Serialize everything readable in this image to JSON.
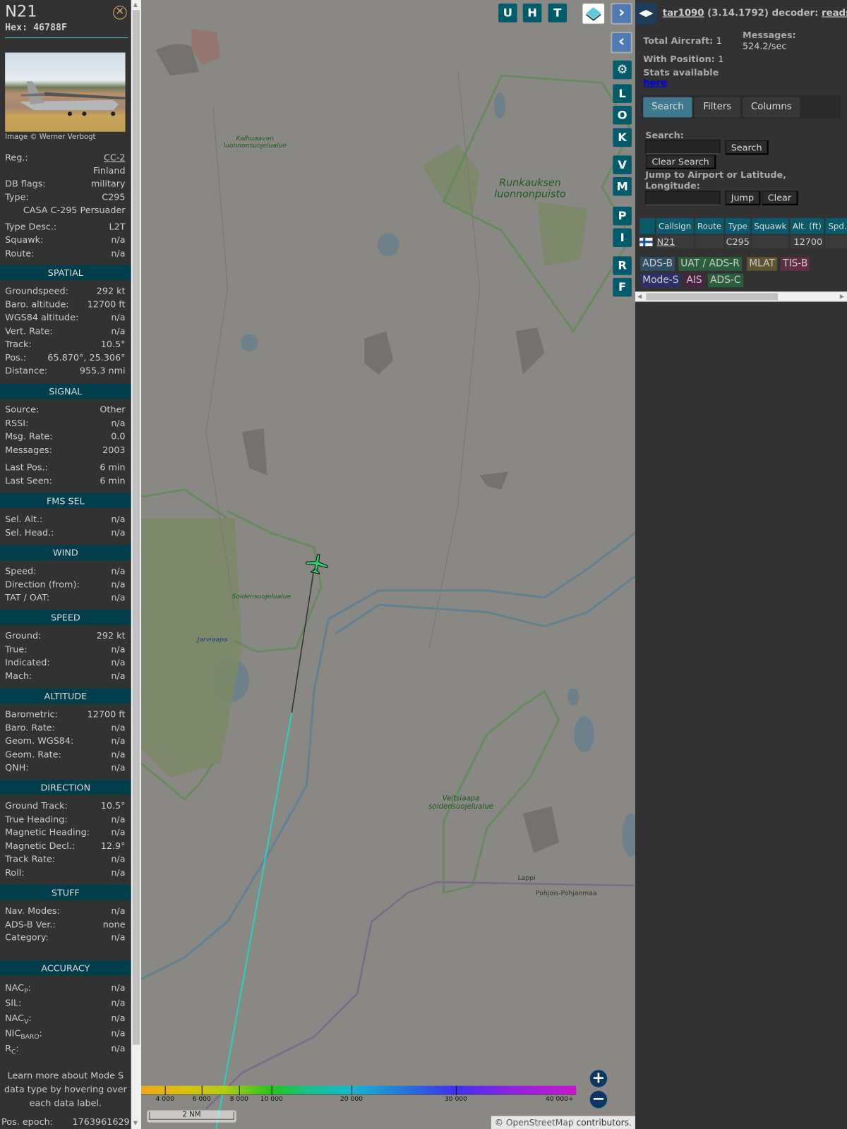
{
  "aircraft": {
    "callsign": "N21",
    "hex_label": "Hex: 46788F",
    "photo_credit": "Image © Werner Verbogt",
    "info": [
      {
        "label": "Reg.:",
        "value": "CC-2",
        "link": true
      },
      {
        "label": "",
        "value": "Finland"
      },
      {
        "label": "DB flags:",
        "value": "military"
      },
      {
        "label": "Type:",
        "value": "C295"
      },
      {
        "label": "",
        "value": "CASA C-295 Persuader"
      },
      {
        "label": "Type Desc.:",
        "value": "L2T"
      },
      {
        "label": "Squawk:",
        "value": "n/a"
      },
      {
        "label": "Route:",
        "value": "n/a"
      }
    ],
    "sections": [
      {
        "title": "SPATIAL",
        "rows": [
          {
            "label": "Groundspeed:",
            "value": "292 kt"
          },
          {
            "label": "Baro. altitude:",
            "value": "12700 ft"
          },
          {
            "label": "WGS84 altitude:",
            "value": "n/a"
          },
          {
            "label": "Vert. Rate:",
            "value": "n/a"
          },
          {
            "label": "Track:",
            "value": "10.5°"
          },
          {
            "label": "Pos.:",
            "value": "65.870°, 25.306°"
          },
          {
            "label": "Distance:",
            "value": "955.3 nmi"
          }
        ]
      },
      {
        "title": "SIGNAL",
        "rows": [
          {
            "label": "Source:",
            "value": "Other"
          },
          {
            "label": "RSSI:",
            "value": "n/a"
          },
          {
            "label": "Msg. Rate:",
            "value": "0.0"
          },
          {
            "label": "Messages:",
            "value": "2003"
          },
          {
            "label": "Last Pos.:",
            "value": "6 min"
          },
          {
            "label": "Last Seen:",
            "value": "6 min"
          }
        ]
      },
      {
        "title": "FMS SEL",
        "rows": [
          {
            "label": "Sel. Alt.:",
            "value": "n/a"
          },
          {
            "label": "Sel. Head.:",
            "value": "n/a"
          }
        ]
      },
      {
        "title": "WIND",
        "rows": [
          {
            "label": "Speed:",
            "value": "n/a"
          },
          {
            "label": "Direction (from):",
            "value": "n/a"
          },
          {
            "label": "TAT / OAT:",
            "value": "n/a"
          }
        ]
      },
      {
        "title": "SPEED",
        "rows": [
          {
            "label": "Ground:",
            "value": "292 kt"
          },
          {
            "label": "True:",
            "value": "n/a"
          },
          {
            "label": "Indicated:",
            "value": "n/a"
          },
          {
            "label": "Mach:",
            "value": "n/a"
          }
        ]
      },
      {
        "title": "ALTITUDE",
        "rows": [
          {
            "label": "Barometric:",
            "value": "12700 ft"
          },
          {
            "label": "Baro. Rate:",
            "value": "n/a"
          },
          {
            "label": "Geom. WGS84:",
            "value": "n/a"
          },
          {
            "label": "Geom. Rate:",
            "value": "n/a"
          },
          {
            "label": "QNH:",
            "value": "n/a"
          }
        ]
      },
      {
        "title": "DIRECTION",
        "rows": [
          {
            "label": "Ground Track:",
            "value": "10.5°"
          },
          {
            "label": "True Heading:",
            "value": "n/a"
          },
          {
            "label": "Magnetic Heading:",
            "value": "n/a"
          },
          {
            "label": "Magnetic Decl.:",
            "value": "12.9°"
          },
          {
            "label": "Track Rate:",
            "value": "n/a"
          },
          {
            "label": "Roll:",
            "value": "n/a"
          }
        ]
      },
      {
        "title": "STUFF",
        "rows": [
          {
            "label": "Nav. Modes:",
            "value": "n/a"
          },
          {
            "label": "ADS-B Ver.:",
            "value": "none"
          },
          {
            "label": "Category:",
            "value": "n/a"
          }
        ]
      },
      {
        "title": "ACCURACY",
        "rows": [
          {
            "label": "NAC",
            "sub": "P",
            "value": "n/a"
          },
          {
            "label": "SIL:",
            "value": "n/a"
          },
          {
            "label": "NAC",
            "sub": "V",
            "value": "n/a"
          },
          {
            "label": "NIC",
            "sub": "BARO",
            "value": "n/a"
          },
          {
            "label": "R",
            "sub": "C",
            "value": "n/a"
          }
        ]
      }
    ],
    "note": "Learn more about Mode S data type by hovering over each data label.",
    "epoch_label": "Pos. epoch:",
    "epoch_value": "1763961629"
  },
  "map": {
    "top_buttons": [
      "U",
      "H",
      "T"
    ],
    "side_buttons": [
      "L",
      "O",
      "K",
      "V",
      "M",
      "P",
      "I",
      "R",
      "F"
    ],
    "labels": [
      {
        "text": "Kalhuaavan luonnonsuojelualue"
      },
      {
        "text": "Runkauksen luonnonpuisto"
      },
      {
        "text": "Soidensuojelualue"
      },
      {
        "text": "Jarviaapa"
      },
      {
        "text": "Veitsiaapa soidensuojelualue"
      },
      {
        "text": "Lappi"
      },
      {
        "text": "Pohjois-Pohjanmaa"
      }
    ],
    "legend_ticks": [
      "4 000",
      "6 000",
      "8 000",
      "10 000",
      "20 000",
      "30 000",
      "40 000+"
    ],
    "scale": "2 NM",
    "attribution_prefix": "© ",
    "attribution_link": "OpenStreetMap",
    "attribution_suffix": " contributors.",
    "track_color": "#1ed8c8",
    "aircraft_color": "#2ecc71"
  },
  "right": {
    "app_name": "tar1090",
    "version": "(3.14.1792) decoder:",
    "decoder": "readsb",
    "total_label": "Total Aircraft:",
    "total": "1",
    "position_label": "With Position:",
    "position": "1",
    "messages_label": "Messages:",
    "messages": "524.2/sec",
    "stats_label": "Stats available",
    "stats_link": "here",
    "tabs": [
      "Search",
      "Filters",
      "Columns"
    ],
    "search_label": "Search:",
    "search_value": "",
    "search_button": "Search",
    "clear_search_button": "Clear Search",
    "jump_label": "Jump to Airport or Latitude, Longitude:",
    "jump_value": "",
    "jump_button": "Jump",
    "clear_button": "Clear",
    "columns": [
      "Callsign",
      "Route",
      "Type",
      "Squawk",
      "Alt. (ft)",
      "Spd."
    ],
    "rows": [
      {
        "flag": "Finland",
        "callsign": "N21",
        "route": "",
        "type": "C295",
        "squawk": "",
        "alt": "12700",
        "spd": ""
      }
    ],
    "badges": [
      {
        "label": "ADS-B",
        "color": "#2e4f66"
      },
      {
        "label": "UAT / ADS-R",
        "color": "#2b5e3c"
      },
      {
        "label": "MLAT",
        "color": "#5e5530"
      },
      {
        "label": "TIS-B",
        "color": "#632e45"
      },
      {
        "label": "Mode-S",
        "color": "#2d2f6b"
      },
      {
        "label": "AIS",
        "color": "#4a2340"
      },
      {
        "label": "ADS-C",
        "color": "#2b5e3c"
      }
    ]
  }
}
